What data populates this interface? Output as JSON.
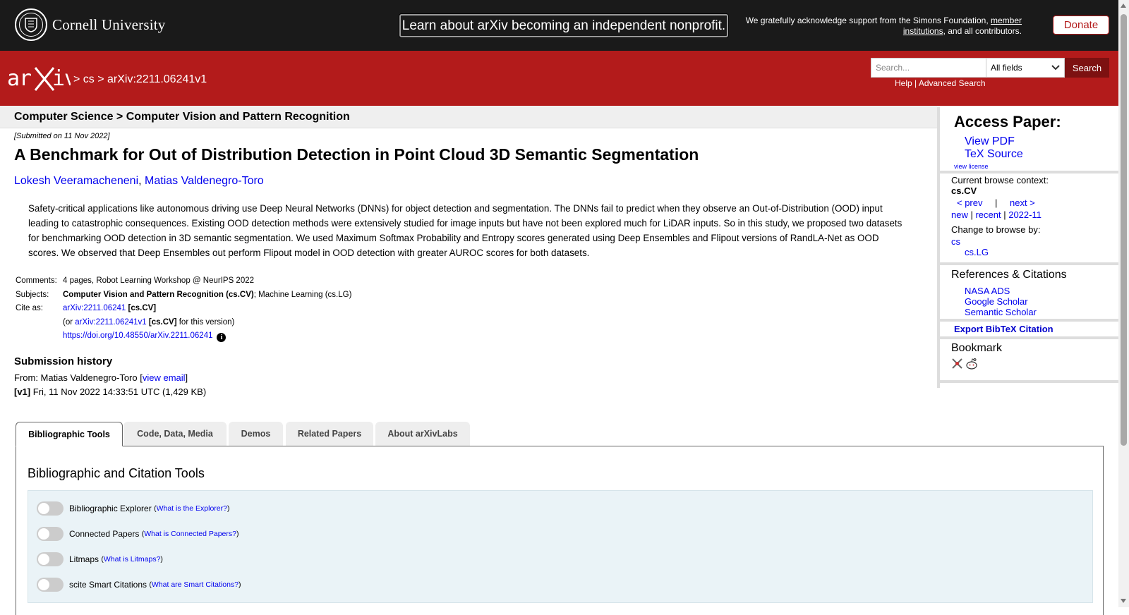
{
  "topbar": {
    "university": "Cornell University",
    "nonprofit_button": "Learn about arXiv becoming an independent nonprofit.",
    "support_text_1": "We gratefully acknowledge support from the Simons Foundation, ",
    "support_link": "member institutions",
    "support_text_2": ", and all contributors.",
    "donate": "Donate"
  },
  "header": {
    "breadcrumb_sep1": "> ",
    "breadcrumb_cs": "cs",
    "breadcrumb_sep2": " > ",
    "breadcrumb_id": "arXiv:2211.06241v1",
    "search_placeholder": "Search...",
    "search_field": "All fields",
    "search_button": "Search",
    "help": "Help",
    "sep": " | ",
    "advanced": "Advanced Search"
  },
  "paper": {
    "subject_line": "Computer Science > Computer Vision and Pattern Recognition",
    "submitted": "[Submitted on 11 Nov 2022]",
    "title": "A Benchmark for Out of Distribution Detection in Point Cloud 3D Semantic Segmentation",
    "authors": [
      "Lokesh Veeramacheneni",
      "Matias Valdenegro-Toro"
    ],
    "author_sep": ", ",
    "abstract": "Safety-critical applications like autonomous driving use Deep Neural Networks (DNNs) for object detection and segmentation. The DNNs fail to predict when they observe an Out-of-Distribution (OOD) input leading to catastrophic consequences. Existing OOD detection methods were extensively studied for image inputs but have not been explored much for LiDAR inputs. So in this study, we proposed two datasets for benchmarking OOD detection in 3D semantic segmentation. We used Maximum Softmax Probability and Entropy scores generated using Deep Ensembles and Flipout versions of RandLA-Net as OOD scores. We observed that Deep Ensembles out perform Flipout model in OOD detection with greater AUROC scores for both datasets."
  },
  "meta": {
    "comments_label": "Comments:",
    "comments": "4 pages, Robot Learning Workshop @ NeurIPS 2022",
    "subjects_label": "Subjects:",
    "subject_primary": "Computer Vision and Pattern Recognition (cs.CV)",
    "subject_rest": "; Machine Learning (cs.LG)",
    "cite_label": "Cite as:",
    "cite_id": "arXiv:2211.06241",
    "cite_cat": " [cs.CV]",
    "or_prefix": "(or ",
    "cite_version": "arXiv:2211.06241v1",
    "cite_cat2": " [cs.CV]",
    "or_suffix": " for this version)",
    "doi": "https://doi.org/10.48550/arXiv.2211.06241",
    "info_icon": "i"
  },
  "history": {
    "title": "Submission history",
    "from_prefix": "From: Matias Valdenegro-Toro [",
    "view_email": "view email",
    "from_suffix": "]",
    "v1_label": "[v1]",
    "v1_text": " Fri, 11 Nov 2022 14:33:51 UTC (1,429 KB)"
  },
  "access": {
    "title": "Access Paper:",
    "view_pdf": "View PDF",
    "tex_source": "TeX Source",
    "view_license": "view license"
  },
  "browse": {
    "context_label": "Current browse context:",
    "context": "cs.CV",
    "prev": "< prev",
    "sep_bar": "|",
    "next": "next >",
    "new": "new",
    "recent": "recent",
    "month": "2022-11",
    "pipe": " | ",
    "change_label": "Change to browse by:",
    "cs": "cs",
    "cslg": "cs.LG"
  },
  "refs": {
    "title": "References & Citations",
    "nasa": "NASA ADS",
    "google": "Google Scholar",
    "semantic": "Semantic Scholar",
    "export": "Export BibTeX Citation"
  },
  "bookmark": {
    "title": "Bookmark",
    "icons": [
      "bibsonomy-icon",
      "reddit-icon"
    ]
  },
  "tabs": [
    "Bibliographic Tools",
    "Code, Data, Media",
    "Demos",
    "Related Papers",
    "About arXivLabs"
  ],
  "tools": {
    "title": "Bibliographic and Citation Tools",
    "rows": [
      {
        "label": "Bibliographic Explorer",
        "help": "What is the Explorer?"
      },
      {
        "label": "Connected Papers",
        "help": "What is Connected Papers?"
      },
      {
        "label": "Litmaps",
        "help": "What is Litmaps?"
      },
      {
        "label": "scite Smart Citations",
        "help": "What are Smart Citations?"
      }
    ]
  },
  "colors": {
    "brand_red": "#b31b1b",
    "dark_bar": "#1a1a1a",
    "link": "#0000ee"
  }
}
